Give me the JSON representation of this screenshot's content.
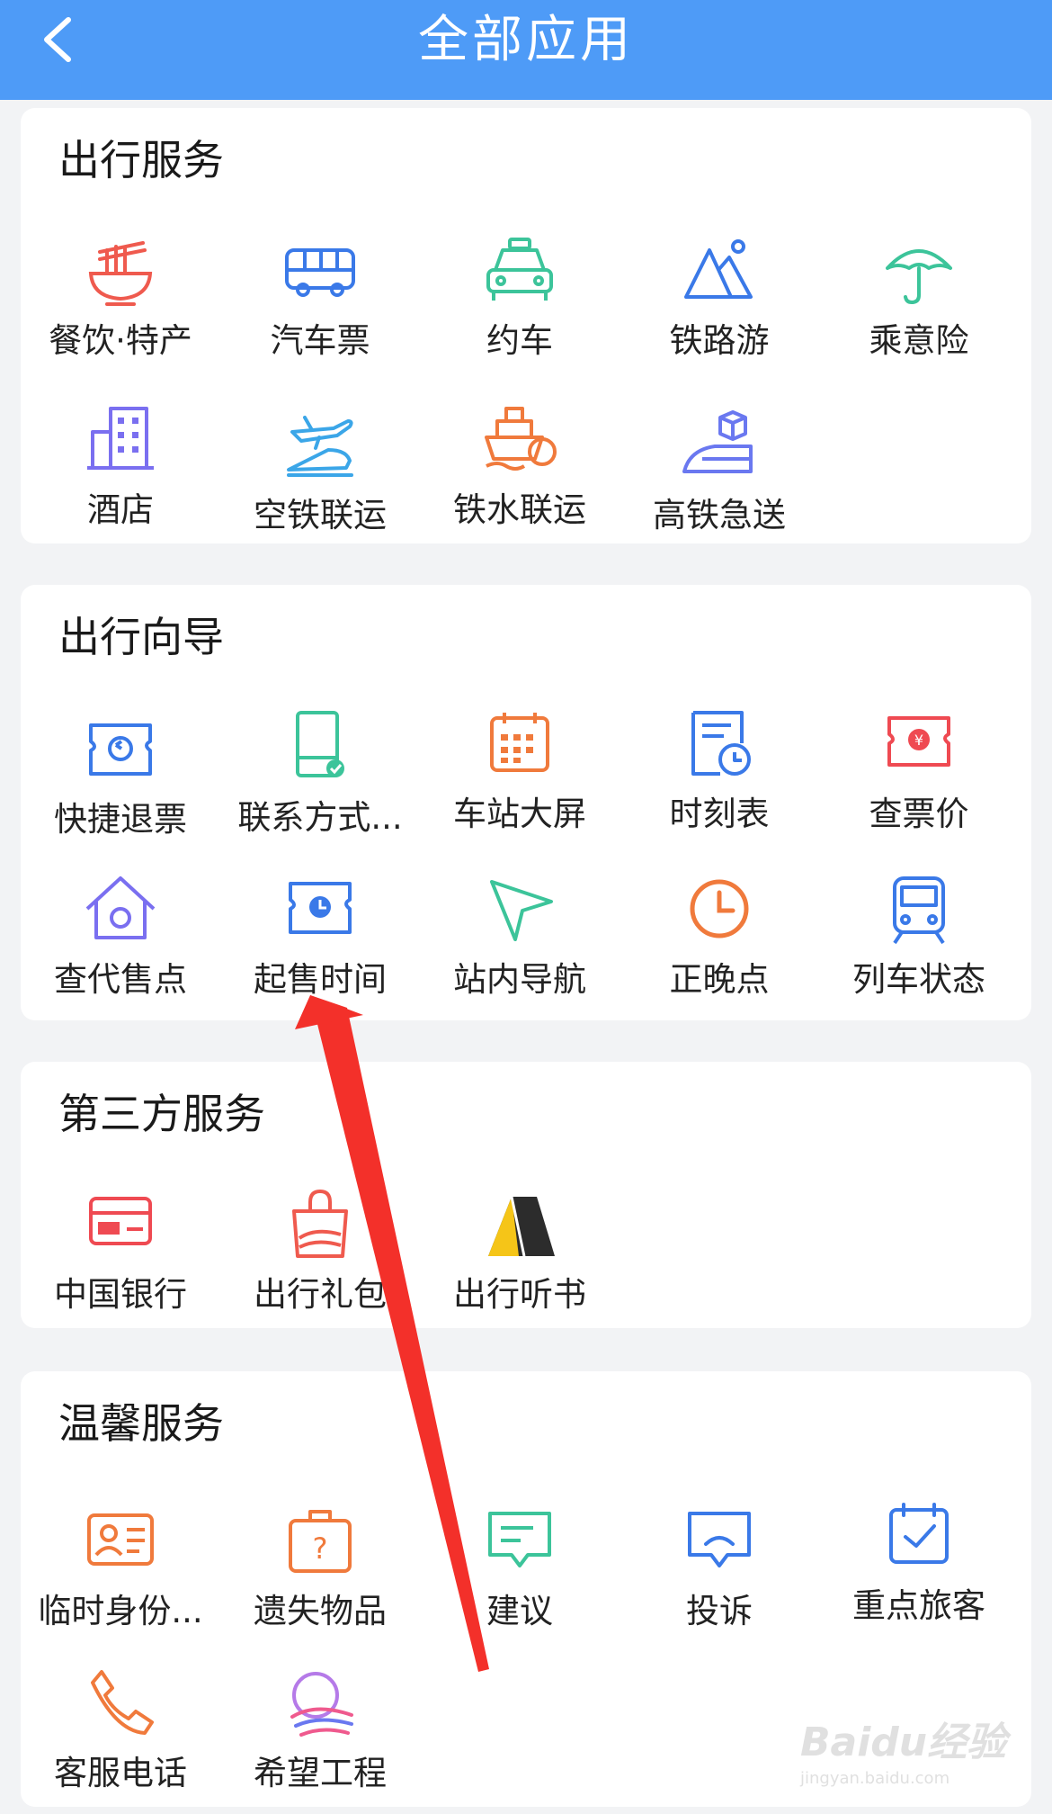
{
  "header": {
    "title": "全部应用"
  },
  "sections": {
    "travel_service": {
      "title": "出行服务",
      "items": [
        "餐饮·特产",
        "汽车票",
        "约车",
        "铁路游",
        "乘意险",
        "酒店",
        "空铁联运",
        "铁水联运",
        "高铁急送"
      ]
    },
    "travel_guide": {
      "title": "出行向导",
      "items": [
        "快捷退票",
        "联系方式...",
        "车站大屏",
        "时刻表",
        "查票价",
        "查代售点",
        "起售时间",
        "站内导航",
        "正晚点",
        "列车状态"
      ]
    },
    "third_party": {
      "title": "第三方服务",
      "items": [
        "中国银行",
        "出行礼包",
        "出行听书"
      ]
    },
    "warm_service": {
      "title": "温馨服务",
      "items": [
        "临时身份...",
        "遗失物品",
        "建议",
        "投诉",
        "重点旅客",
        "客服电话",
        "希望工程"
      ]
    }
  },
  "colors": {
    "header": "#4e9bf7",
    "annotation_arrow": "#f3302a"
  },
  "watermark": {
    "logo": "Baidu经验",
    "url": "jingyan.baidu.com"
  }
}
